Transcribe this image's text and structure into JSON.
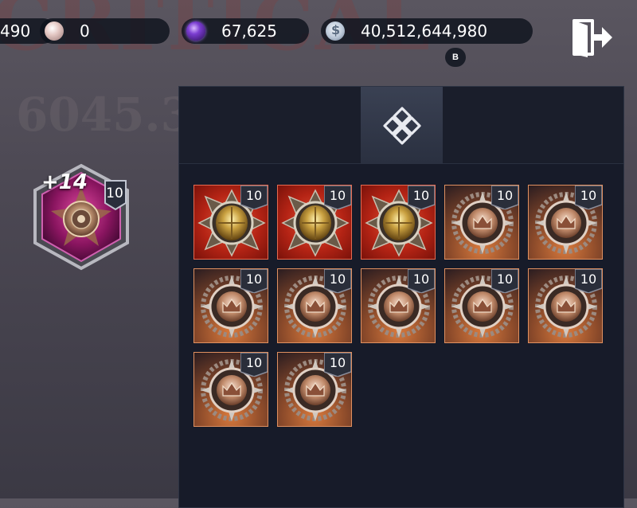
{
  "background": {
    "title_text": "CRITICAL",
    "number_text": "6045.3"
  },
  "currencies": [
    {
      "icon": "unknown-currency-icon",
      "value": "490"
    },
    {
      "icon": "pearl-icon",
      "value": "0"
    },
    {
      "icon": "purple-orb-icon",
      "value": "67,625"
    },
    {
      "icon": "silver-coin-icon",
      "value": "40,512,644,980"
    }
  ],
  "currency_badge": "B",
  "character": {
    "bonus": "+14",
    "level": "10",
    "frame_color": "#b0207a"
  },
  "panel": {
    "active_tab_icon": "knot-emblem-icon"
  },
  "items": [
    {
      "type": "gold-shield",
      "rarity": "red",
      "level": "10"
    },
    {
      "type": "gold-shield",
      "rarity": "red",
      "level": "10"
    },
    {
      "type": "gold-shield",
      "rarity": "red",
      "level": "10"
    },
    {
      "type": "crown-seal",
      "rarity": "bronze",
      "level": "10"
    },
    {
      "type": "crown-seal",
      "rarity": "bronze",
      "level": "10"
    },
    {
      "type": "crown-seal",
      "rarity": "bronze",
      "level": "10"
    },
    {
      "type": "crown-seal",
      "rarity": "bronze",
      "level": "10"
    },
    {
      "type": "crown-seal",
      "rarity": "bronze",
      "level": "10"
    },
    {
      "type": "crown-seal",
      "rarity": "bronze",
      "level": "10"
    },
    {
      "type": "crown-seal",
      "rarity": "bronze",
      "level": "10"
    },
    {
      "type": "crown-seal",
      "rarity": "bronze",
      "level": "10"
    },
    {
      "type": "crown-seal",
      "rarity": "bronze",
      "level": "10"
    }
  ]
}
